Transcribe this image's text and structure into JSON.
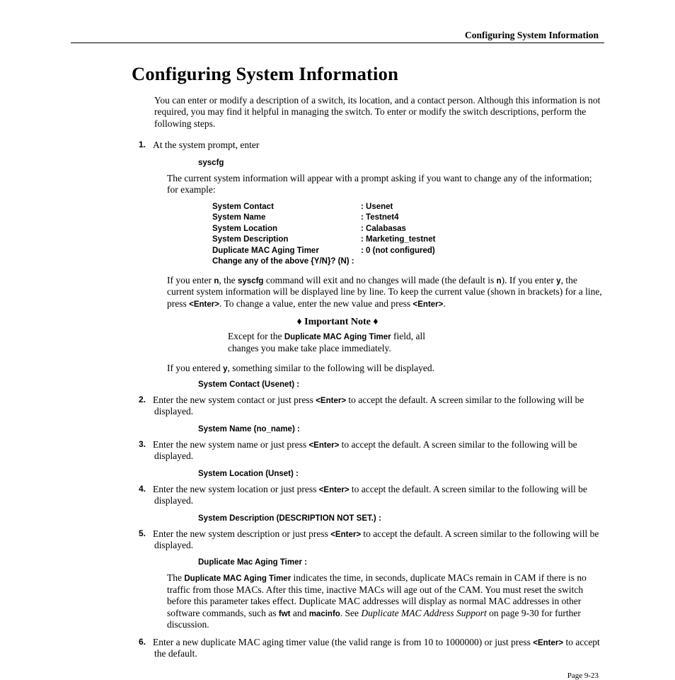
{
  "header": {
    "running": "Configuring System Information"
  },
  "title": "Configuring System Information",
  "intro": "You can enter or modify a description of a switch, its location, and a contact person. Although this information is not required, you may find it helpful in managing the switch. To enter or modify the switch descriptions, perform the following steps.",
  "steps": {
    "s1_num": "1.",
    "s1_lead": "At the system prompt, enter",
    "s1_cmd": "syscfg",
    "s1_after": "The current system information will appear with a prompt asking if you want to change any of the information; for example:",
    "sys": {
      "r1l": "System Contact",
      "r1v": ": Usenet",
      "r2l": "System Name",
      "r2v": ": Testnet4",
      "r3l": "System Location",
      "r3v": ": Calabasas",
      "r4l": "System Description",
      "r4v": ": Marketing_testnet",
      "r5l": "Duplicate MAC Aging Timer",
      "r5v": ": 0 (not configured)",
      "r6l": "Change any of the above {Y/N}?  (N) :",
      "r6v": ""
    },
    "s1_p2a": "If you enter ",
    "s1_p2b": ", the ",
    "s1_p2c": " command will exit and no changes will made (the default is ",
    "s1_p2d": "). If you enter ",
    "s1_p2e": ", the current system information will be displayed line by line. To keep the current value (shown in brackets) for a line, press ",
    "s1_p2f": ". To change a value, enter the new value and press ",
    "s1_p2g": ".",
    "note_title": "♦ Important Note ♦",
    "note_a": "Except for the ",
    "note_field": "Duplicate MAC Aging Timer",
    "note_b": " field, all changes you make take place immediately.",
    "s1_p3a": "If you entered ",
    "s1_p3b": ", something similar to the following will be displayed.",
    "s1_cmd2": "System Contact (Usenet)  :",
    "s2_num": "2.",
    "s2_a": "Enter the new system contact or just press ",
    "s2_b": " to accept the default. A screen similar to the following will be displayed.",
    "s2_cmd": "System Name (no_name)  :",
    "s3_num": "3.",
    "s3_a": "Enter the new system name or just press ",
    "s3_b": " to accept the default. A screen similar to the following will be displayed.",
    "s3_cmd": "System Location (Unset)  :",
    "s4_num": "4.",
    "s4_a": "Enter the new system location or just press ",
    "s4_b": " to accept the default. A screen similar to the following will be displayed.",
    "s4_cmd": "System Description (DESCRIPTION NOT SET.) :",
    "s5_num": "5.",
    "s5_a": "Enter the new system description or just press ",
    "s5_b": " to accept the default. A screen similar to the following will be displayed.",
    "s5_cmd": "Duplicate Mac Aging Timer :",
    "s5_p2a": "The ",
    "s5_p2b": " indicates the time, in seconds, duplicate ",
    "s5_p2c": "s remain in ",
    "s5_p2d": " if there is no traffic from those ",
    "s5_p2e": "s. After this time, inactive ",
    "s5_p2f": "s will age out of the ",
    "s5_p2g": ". You must reset the switch before this parameter takes effect. Duplicate ",
    "s5_p2h": " addresses will display as normal ",
    "s5_p2i": " addresses in other software commands, such as ",
    "s5_p2j": " and ",
    "s5_p2k": ". See ",
    "s5_p2l": " on page 9-30 for further discussion.",
    "s6_num": "6.",
    "s6_a": "Enter a new duplicate ",
    "s6_b": " aging timer value (the valid range is from 10 to 1000000) or just press ",
    "s6_c": " to accept the default.",
    "n": "n",
    "y": "y",
    "syscfg": "syscfg",
    "enter": "<Enter>",
    "dmat": "Duplicate MAC Aging Timer",
    "mac": "MAC",
    "cam": "CAM",
    "fwt": "fwt",
    "macinfo": "macinfo",
    "duplink": "Duplicate MAC Address Support"
  },
  "footer": "Page 9-23"
}
